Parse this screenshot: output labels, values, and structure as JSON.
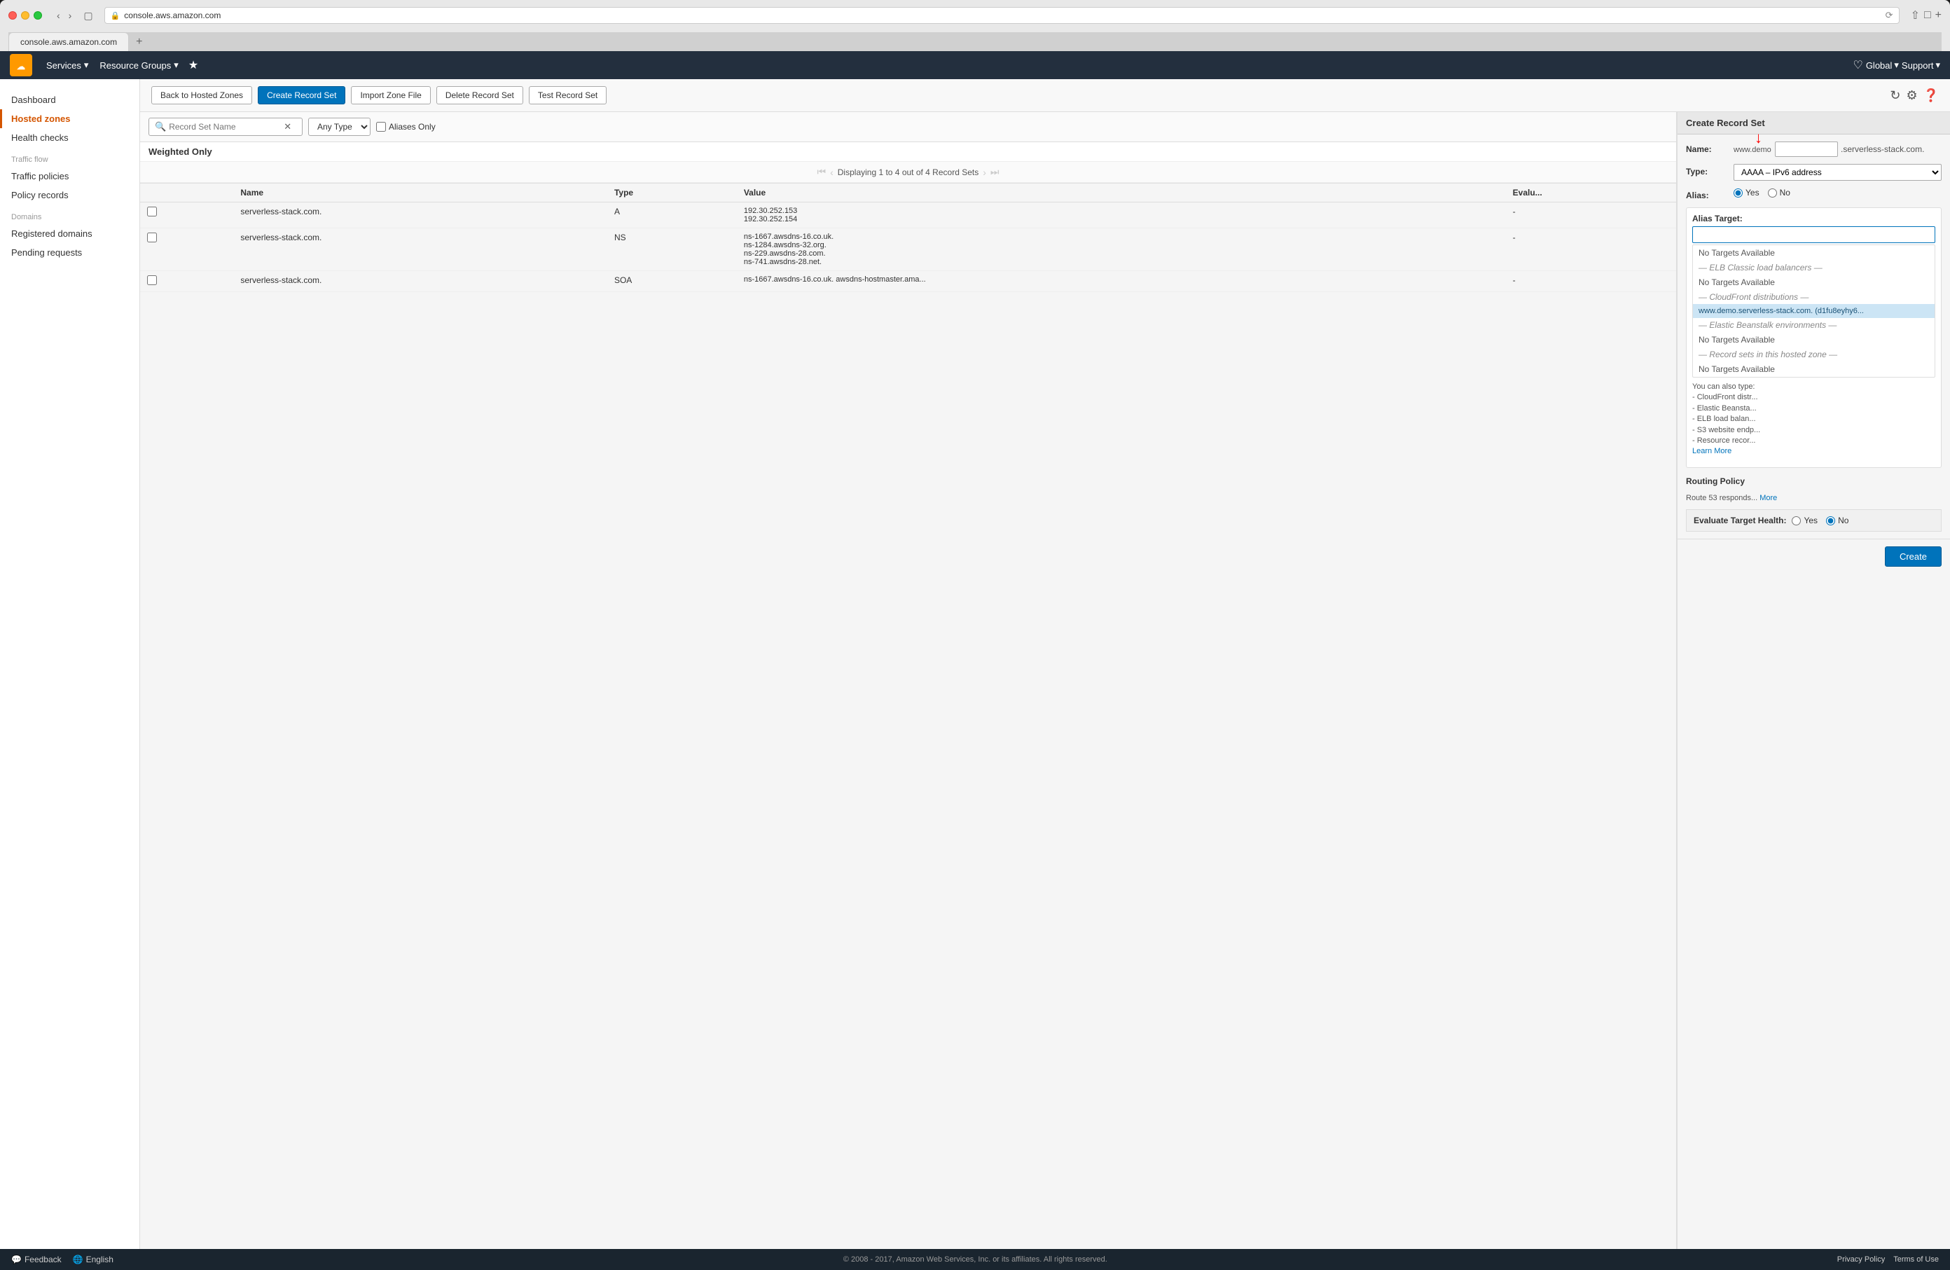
{
  "browser": {
    "url": "console.aws.amazon.com",
    "tab_title": "console.aws.amazon.com"
  },
  "navbar": {
    "services_label": "Services",
    "resource_groups_label": "Resource Groups",
    "global_label": "Global",
    "support_label": "Support"
  },
  "sidebar": {
    "dashboard_label": "Dashboard",
    "hosted_zones_label": "Hosted zones",
    "health_checks_label": "Health checks",
    "traffic_flow_label": "Traffic flow",
    "traffic_policies_label": "Traffic policies",
    "policy_records_label": "Policy records",
    "domains_label": "Domains",
    "registered_domains_label": "Registered domains",
    "pending_requests_label": "Pending requests"
  },
  "toolbar": {
    "back_label": "Back to Hosted Zones",
    "create_label": "Create Record Set",
    "import_label": "Import Zone File",
    "delete_label": "Delete Record Set",
    "test_label": "Test Record Set"
  },
  "search": {
    "placeholder": "Record Set Name",
    "type_default": "Any Type",
    "aliases_label": "Aliases Only"
  },
  "filter": {
    "label": "Weighted Only"
  },
  "pagination": {
    "text": "Displaying 1 to 4 out of 4 Record Sets"
  },
  "table": {
    "headers": [
      "",
      "Name",
      "Type",
      "Value",
      "Evaluate"
    ],
    "rows": [
      {
        "name": "serverless-stack.com.",
        "type": "A",
        "value": "192.30.252.153\n192.30.252.154",
        "evaluate": "-"
      },
      {
        "name": "serverless-stack.com.",
        "type": "NS",
        "value": "ns-1667.awsdns-16.co.uk.\nns-1284.awsdns-32.org.\nns-229.awsdns-28.com.\nns-741.awsdns-28.net.",
        "evaluate": "-"
      },
      {
        "name": "serverless-stack.com.",
        "type": "SOA",
        "value": "ns-1667.awsdns-16.co.uk. awsdns-hostmaster.ama...",
        "evaluate": "-"
      }
    ]
  },
  "panel": {
    "title": "Create Record Set",
    "name_label": "Name:",
    "name_value": "",
    "name_suffix": ".serverless-stack.com.",
    "name_prefix": "www.demo",
    "type_label": "Type:",
    "type_value": "AAAA – IPv6 address",
    "alias_label": "Alias:",
    "alias_yes": "Yes",
    "alias_no": "No",
    "alias_target_label": "Alias Target:",
    "alias_target_hint1": "You can also type:",
    "alias_target_hint2": "- CloudFront distr...",
    "alias_target_hint3": "- Elastic Beansta...",
    "alias_target_hint4": "- ELB load balan...",
    "alias_target_hint5": "- S3 website endp...",
    "alias_target_hint6": "- Resource recor...",
    "learn_more": "Learn More",
    "routing_policy_label": "Routing Policy",
    "routing_desc": "Route 53 responds...",
    "more_link": "More",
    "evaluate_label": "Evaluate Target Health:",
    "evaluate_yes": "Yes",
    "evaluate_no": "No",
    "create_btn": "Create"
  },
  "dropdown": {
    "items": [
      {
        "type": "no-targets",
        "text": "No Targets Available"
      },
      {
        "type": "section-header",
        "text": "— ELB Classic load balancers —"
      },
      {
        "type": "no-targets",
        "text": "No Targets Available"
      },
      {
        "type": "section-header",
        "text": "— CloudFront distributions —"
      },
      {
        "type": "highlighted",
        "text": "www.demo.serverless-stack.com. (d1fu8eyhy6..."
      },
      {
        "type": "section-header",
        "text": "— Elastic Beanstalk environments —"
      },
      {
        "type": "no-targets",
        "text": "No Targets Available"
      },
      {
        "type": "section-header",
        "text": "— Record sets in this hosted zone —"
      },
      {
        "type": "no-targets",
        "text": "No Targets Available"
      }
    ]
  },
  "footer": {
    "feedback_label": "Feedback",
    "language_label": "English",
    "copyright": "© 2008 - 2017, Amazon Web Services, Inc. or its affiliates. All rights reserved.",
    "privacy_label": "Privacy Policy",
    "terms_label": "Terms of Use"
  }
}
